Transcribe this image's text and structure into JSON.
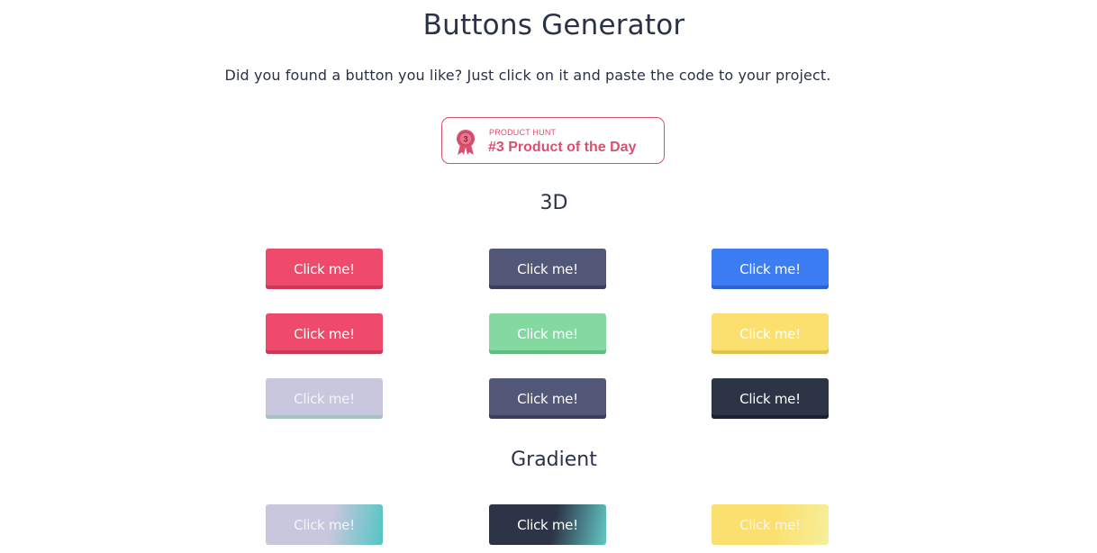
{
  "header": {
    "title": "Buttons Generator",
    "subtitle": "Did you found a button you like? Just click on it and paste the code to your project."
  },
  "badge": {
    "small_text": "PRODUCT HUNT",
    "big_text": "#3 Product of the Day",
    "medal_number": "3",
    "color": "#da4f6e"
  },
  "sections": [
    {
      "heading": "3D",
      "buttons": [
        {
          "label": "Click me!",
          "style": "3d",
          "color": "#ef4a6c",
          "shadow": "#c83a58"
        },
        {
          "label": "Click me!",
          "style": "3d",
          "color": "#545878",
          "shadow": "#3b3e59"
        },
        {
          "label": "Click me!",
          "style": "3d",
          "color": "#3d7df4",
          "shadow": "#2f63c9"
        },
        {
          "label": "Click me!",
          "style": "3d",
          "color": "#ef4a6c",
          "shadow": "#c83a58"
        },
        {
          "label": "Click me!",
          "style": "3d",
          "color": "#84d9a1",
          "shadow": "#66b884"
        },
        {
          "label": "Click me!",
          "style": "3d",
          "color": "#fbe070",
          "shadow": "#e0c350"
        },
        {
          "label": "Click me!",
          "style": "3d",
          "color": "#c9c7dd",
          "shadow": "#a5c2bf"
        },
        {
          "label": "Click me!",
          "style": "3d",
          "color": "#545878",
          "shadow": "#3b3e59"
        },
        {
          "label": "Click me!",
          "style": "3d",
          "color": "#2d3445",
          "shadow": "#1c2230"
        }
      ]
    },
    {
      "heading": "Gradient",
      "buttons": [
        {
          "label": "Click me!",
          "style": "gradient",
          "color": "#c9c7dd",
          "color2": "#52c5c4"
        },
        {
          "label": "Click me!",
          "style": "gradient",
          "color": "#2e3447",
          "color2": "#61c8c4"
        },
        {
          "label": "Click me!",
          "style": "gradient",
          "color": "#fbe070",
          "color2": "#f7ef9a"
        }
      ]
    }
  ]
}
